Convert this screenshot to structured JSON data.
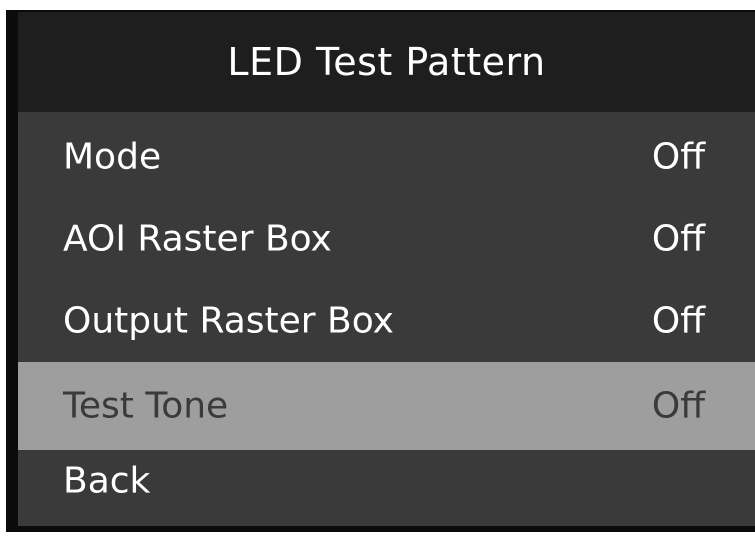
{
  "menu": {
    "title": "LED Test Pattern",
    "items": [
      {
        "label": "Mode",
        "value": "Off"
      },
      {
        "label": "AOI Raster Box",
        "value": "Off"
      },
      {
        "label": "Output Raster Box",
        "value": "Off"
      },
      {
        "label": "Test Tone",
        "value": "Off",
        "selected": true
      },
      {
        "label": "Back",
        "value": ""
      }
    ]
  },
  "colors": {
    "title_bg": "#1e1e1e",
    "panel_bg": "#3a3a3a",
    "selected_bg": "#9e9e9e",
    "text": "#ffffff",
    "selected_text": "#3a3a3a"
  }
}
